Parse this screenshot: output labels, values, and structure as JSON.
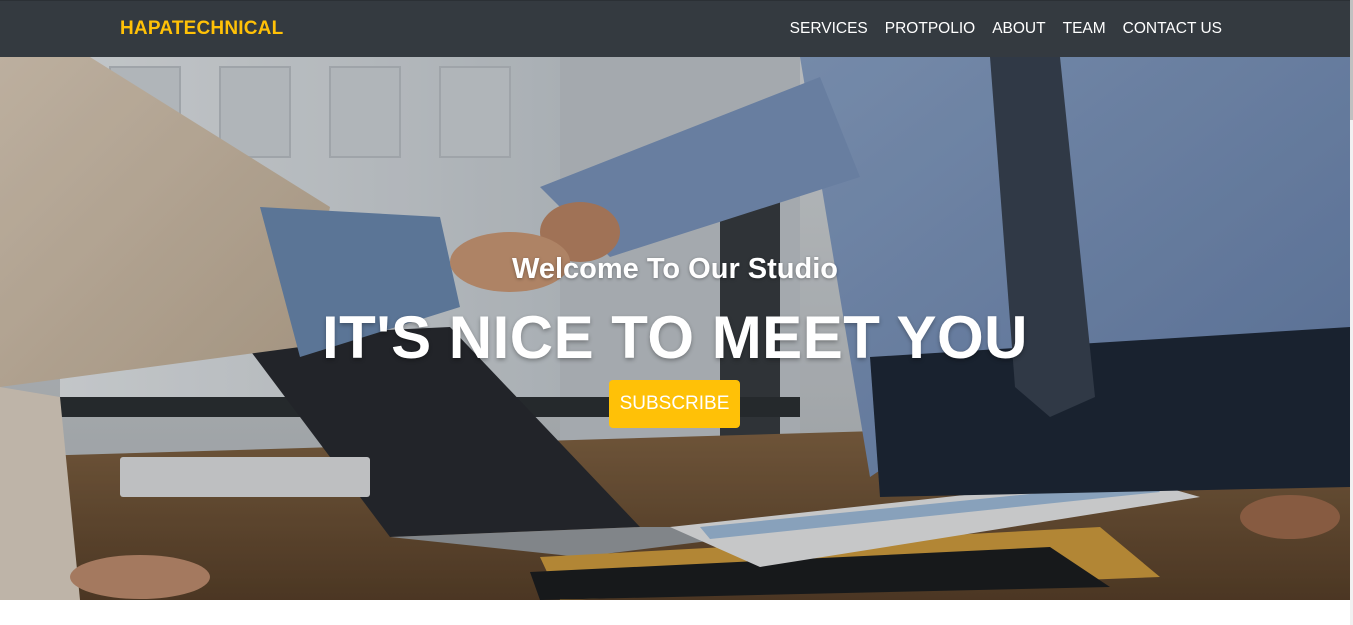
{
  "navbar": {
    "brand": "HAPATECHNICAL",
    "links": [
      "SERVICES",
      "PROTPOLIO",
      "ABOUT",
      "TEAM",
      "CONTACT US"
    ]
  },
  "hero": {
    "subheading": "Welcome To Our Studio",
    "heading": "IT'S NICE TO MEET YOU",
    "button_label": "SUBSCRIBE",
    "image_description": "business-handshake-photo"
  },
  "colors": {
    "navbar_bg": "#343a40",
    "accent": "#ffc107",
    "text_light": "#ffffff"
  }
}
